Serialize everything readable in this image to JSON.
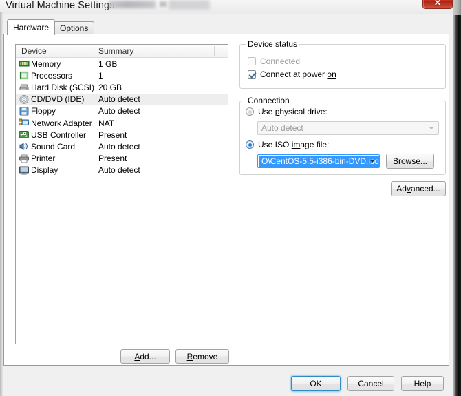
{
  "window": {
    "title": "Virtual Machine Settings",
    "close_label": "✕",
    "close_icon": "close-icon"
  },
  "tabs": [
    {
      "label": "Hardware",
      "active": true
    },
    {
      "label": "Options",
      "active": false
    }
  ],
  "device_list": {
    "columns": [
      "Device",
      "Summary"
    ],
    "rows": [
      {
        "icon": "memory-icon",
        "name": "Memory",
        "summary": "1 GB",
        "selected": false
      },
      {
        "icon": "processor-icon",
        "name": "Processors",
        "summary": "1",
        "selected": false
      },
      {
        "icon": "hard-disk-icon",
        "name": "Hard Disk (SCSI)",
        "summary": "20 GB",
        "selected": false
      },
      {
        "icon": "cd-dvd-icon",
        "name": "CD/DVD (IDE)",
        "summary": "Auto detect",
        "selected": true
      },
      {
        "icon": "floppy-icon",
        "name": "Floppy",
        "summary": "Auto detect",
        "selected": false
      },
      {
        "icon": "network-adapter-icon",
        "name": "Network Adapter",
        "summary": "NAT",
        "selected": false
      },
      {
        "icon": "usb-controller-icon",
        "name": "USB Controller",
        "summary": "Present",
        "selected": false
      },
      {
        "icon": "sound-card-icon",
        "name": "Sound Card",
        "summary": "Auto detect",
        "selected": false
      },
      {
        "icon": "printer-icon",
        "name": "Printer",
        "summary": "Present",
        "selected": false
      },
      {
        "icon": "display-icon",
        "name": "Display",
        "summary": "Auto detect",
        "selected": false
      }
    ],
    "add_label": "Add...",
    "remove_label": "Remove"
  },
  "device_status": {
    "title": "Device status",
    "connected": {
      "label": "Connected",
      "checked": false,
      "disabled": true
    },
    "connect_at_power_on": {
      "label": "Connect at power on",
      "checked": true,
      "disabled": false
    }
  },
  "connection": {
    "title": "Connection",
    "use_physical_drive": {
      "label": "Use physical drive:",
      "selected": false
    },
    "physical_drive_value": "Auto detect",
    "use_iso_image": {
      "label": "Use ISO image file:",
      "selected": true
    },
    "iso_path": "O\\CentOS-5.5-i386-bin-DVD.iso",
    "browse_label": "Browse...",
    "advanced_label": "Advanced..."
  },
  "footer": {
    "ok_label": "OK",
    "cancel_label": "Cancel",
    "help_label": "Help"
  },
  "colors": {
    "selection_blue": "#3399ff",
    "focus_blue": "#2d8bc9",
    "close_red": "#c23323",
    "row_highlight": "#eeeeee"
  }
}
